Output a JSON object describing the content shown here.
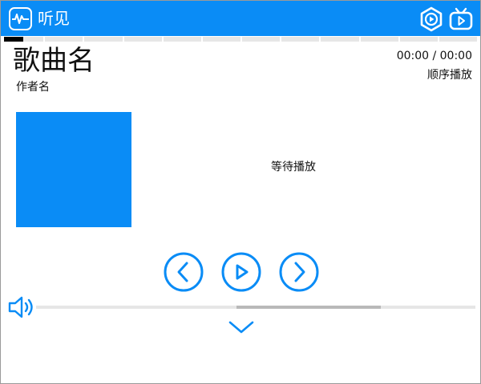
{
  "app": {
    "title": "听见",
    "accent_color": "#0a8cf6",
    "icons": {
      "logo": "waveform-icon",
      "video": "hexagon-play-icon",
      "tv": "tv-icon"
    }
  },
  "progress": {
    "fraction": 0.04
  },
  "song": {
    "title": "歌曲名",
    "artist": "作者名"
  },
  "playback": {
    "time": "00:00 / 00:00",
    "mode": "顺序播放",
    "status": "等待播放"
  },
  "controls": {
    "icons": [
      "previous-icon",
      "play-icon",
      "next-icon"
    ]
  },
  "volume": {
    "icon": "speaker-icon",
    "expand_icon": "chevron-down-icon"
  }
}
